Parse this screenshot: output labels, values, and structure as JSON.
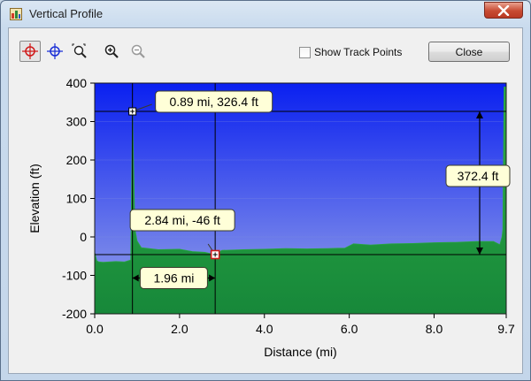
{
  "window": {
    "title": "Vertical Profile"
  },
  "toolbar": {
    "tools": [
      {
        "icon": "target-crosshair-red-icon",
        "active": true
      },
      {
        "icon": "target-crosshair-blue-icon",
        "active": false
      },
      {
        "icon": "zoom-box-icon",
        "active": false
      },
      {
        "icon": "zoom-in-icon",
        "active": false
      },
      {
        "icon": "zoom-out-icon",
        "active": false
      }
    ],
    "show_track_points_label": "Show Track Points",
    "show_track_points_checked": false,
    "close_label": "Close"
  },
  "colors": {
    "sky_top": "#0a20f0",
    "sky_bottom": "#9aa6e8",
    "ground_top": "#2fae45",
    "ground_bottom": "#17883a",
    "callout_bg": "#ffffd8",
    "marker_red": "#d01818"
  },
  "chart_data": {
    "type": "area",
    "title": "",
    "xlabel": "Distance    (mi)",
    "ylabel": "Elevation (ft)",
    "xlim": [
      0,
      9.7
    ],
    "ylim": [
      -200,
      400
    ],
    "x_ticks": [
      "0.0",
      "2.0",
      "4.0",
      "6.0",
      "8.0",
      "9.7"
    ],
    "y_ticks": [
      "400",
      "300",
      "200",
      "100",
      "0",
      "-100",
      "-200"
    ],
    "series": [
      {
        "x": [
          0.0,
          0.05,
          0.1,
          0.2,
          0.5,
          0.7,
          0.85,
          0.89,
          0.95,
          1.0,
          1.1,
          1.5,
          2.0,
          2.3,
          2.6,
          2.84,
          3.0,
          3.5,
          4.0,
          4.5,
          5.0,
          5.5,
          5.9,
          6.1,
          6.5,
          7.0,
          7.5,
          8.0,
          8.5,
          9.0,
          9.4,
          9.55,
          9.6,
          9.62,
          9.65,
          9.7
        ],
        "y": [
          -40,
          -62,
          -65,
          -66,
          -64,
          -65,
          -60,
          326.4,
          20,
          -10,
          -28,
          -33,
          -32,
          -38,
          -40,
          -46,
          -35,
          -33,
          -32,
          -30,
          -31,
          -30,
          -29,
          -18,
          -21,
          -18,
          -17,
          -15,
          -14,
          -12,
          -12,
          -20,
          0,
          20,
          390,
          390
        ]
      }
    ],
    "annotations": [
      {
        "x": 0.89,
        "y": 326.4,
        "label": "0.89 mi, 326.4 ft",
        "marker": "white"
      },
      {
        "x": 2.84,
        "y": -46,
        "label": "2.84 mi, -46 ft",
        "marker": "red"
      },
      {
        "type": "horizontal-span",
        "x_from": 0.89,
        "x_to": 2.84,
        "label": "1.96 mi"
      },
      {
        "type": "vertical-span",
        "y_from": -46,
        "y_to": 326.4,
        "label": "372.4 ft"
      }
    ]
  }
}
